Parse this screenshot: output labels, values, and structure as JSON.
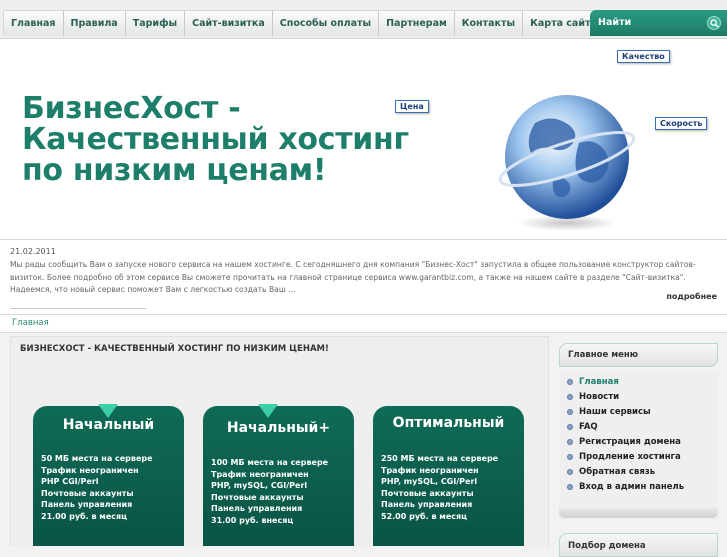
{
  "nav": {
    "items": [
      "Главная",
      "Правила",
      "Тарифы",
      "Сайт-визитка",
      "Способы оплаты",
      "Партнерам",
      "Контакты",
      "Карта сайта"
    ],
    "search_label": "Найти",
    "accent": "#1d7e69"
  },
  "banner": {
    "headline": [
      "БизнесХост -",
      "Качественный хостинг",
      "по низким ценам!"
    ],
    "tags": {
      "quality": "Качество",
      "price": "Цена",
      "speed": "Скорость"
    }
  },
  "news": {
    "date": "21.02.2011",
    "text": "Мы рады сообщить Вам о запуске нового сервиса на нашем хостинге. С сегодняшнего дня компания \"Бизнес-Хост\" запустила в общее пользование конструктор сайтов-визиток. Более подробно об этом сервисе Вы сможете прочитать на главной странице сервиса www.garantbiz.com, а также на нашем сайте в разделе \"Сайт-визитка\". Надеемся, что новый сервис поможет Вам с легкостью создать Ваш ...",
    "more": "подробнее"
  },
  "breadcrumb": "Главная",
  "main": {
    "title": "БИЗНЕСХОСТ - КАЧЕСТВЕННЫЙ ХОСТИНГ ПО НИЗКИМ ЦЕНАМ!",
    "plans": [
      {
        "name": "Начальный",
        "features": [
          "50  МБ  места  на сервере",
          "Трафик неограничен",
          "PHP CGI/Perl",
          "Почтовые аккаунты",
          "Панель управления",
          "21.00 руб. в месяц"
        ]
      },
      {
        "name": "Начальный+",
        "features": [
          "100 МБ места на сервере",
          "Трафик неограничен",
          "PHP, mySQL, CGI/Perl",
          "Почтовые аккаунты",
          "Панель управления",
          "31.00 руб. внесяц"
        ]
      },
      {
        "name": "Оптимальный",
        "features": [
          "250 МБ места на сервере",
          "Трафик неограничен",
          "PHP, mySQL, CGI/Perl",
          "Почтовые аккаунты",
          "Панель управления",
          "52.00 руб. в месяц"
        ]
      }
    ]
  },
  "sidebar": {
    "menu_title": "Главное меню",
    "items": [
      "Главная",
      "Новости",
      "Наши сервисы",
      "FAQ",
      "Регистрация домена",
      "Продление хостинга",
      "Обратная связь",
      "Вход в админ панель"
    ],
    "next_title": "Подбор домена"
  }
}
